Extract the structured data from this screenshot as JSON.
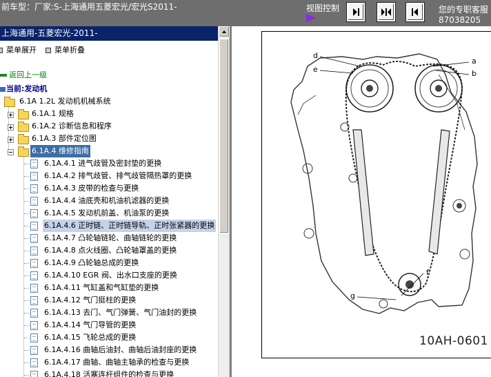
{
  "topbar": {
    "title": "前车型：厂家:S-上海通用五菱宏光/宏光S2011-",
    "view_control_label": "视图控制",
    "contact_line1": "您的专职客服",
    "contact_line2": "87038205"
  },
  "panel": {
    "header": "上海通用-五菱宏光-2011-",
    "expand_label": "菜单展开",
    "collapse_label": "菜单折叠"
  },
  "tree": {
    "back_label": "返回上一级",
    "current_label": "当前:发动机",
    "root_label": "6.1A 1.2L 发动机机械系统",
    "folders": [
      "6.1A.1 规格",
      "6.1A.2 诊断信息和程序",
      "6.1A.3 部件定位图",
      "6.1A.4 维修指南"
    ],
    "items": [
      "6.1A.4.1 进气歧管及密封垫的更换",
      "6.1A.4.2 排气歧管、排气歧管隔热罩的更换",
      "6.1A.4.3 皮带的检查与更换",
      "6.1A.4.4 油底壳和机油机滤器的更换",
      "6.1A.4.5 发动机前盖、机油泵的更换",
      "6.1A.4.6 正时链、正时链导轨、正时张紧器的更换",
      "6.1A.4.7 凸轮轴链轮、曲轴链轮的更换",
      "6.1A.4.8 点火线圈、凸轮轴罩盖的更换",
      "6.1A.4.9 凸轮轴总成的更换",
      "6.1A.4.10 EGR 阀、出水口支座的更换",
      "6.1A.4.11 气缸盖和气缸垫的更换",
      "6.1A.4.12 气门挺柱的更换",
      "6.1A.4.13 去门、气门弹簧、气门油封的更换",
      "6.1A.4.14 气门导管的更换",
      "6.1A.4.15 飞轮总成的更换",
      "6.1A.4.16 曲轴后油封、曲轴后油封座的更换",
      "6.1A.4.17 曲轴、曲轴主轴承的检查与更换",
      "6.1A.4.18 活塞连杆组件的检查与更换"
    ]
  },
  "figure": {
    "labels": [
      "d",
      "e",
      "a",
      "b",
      "f",
      "g"
    ],
    "code": "10AH-0601"
  },
  "colors": {
    "header_bg": "#0a246a",
    "topbar_bg": "#6e6e6e",
    "link": "#008000",
    "selected_bg": "#3a6ea5",
    "hover_bg": "#c6d2ea"
  }
}
